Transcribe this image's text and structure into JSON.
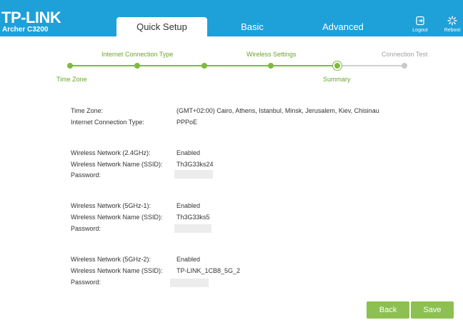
{
  "header": {
    "brand": "TP-LINK",
    "model": "Archer C3200",
    "tabs": [
      "Quick Setup",
      "Basic",
      "Advanced"
    ],
    "logout_label": "Logout",
    "reboot_label": "Reboot",
    "colors": {
      "header_bg": "#1ea0d8",
      "accent_green": "#7dbb3d"
    }
  },
  "steps": [
    {
      "label": "Time Zone",
      "state": "done"
    },
    {
      "label": "Internet Connection Type",
      "state": "done"
    },
    {
      "label": "",
      "state": "done"
    },
    {
      "label": "Wireless Settings",
      "state": "done"
    },
    {
      "label": "Summary",
      "state": "current"
    },
    {
      "label": "Connection Test",
      "state": "todo"
    }
  ],
  "summary": {
    "time_zone_label": "Time Zone:",
    "time_zone_value": "(GMT+02:00) Cairo, Athens, Istanbul, Minsk, Jerusalem, Kiev, Chisinau",
    "connection_type_label": "Internet Connection Type:",
    "connection_type_value": "PPPoE",
    "wifi_24": {
      "network_label": "Wireless Network (2.4GHz):",
      "network_value": "Enabled",
      "ssid_label": "Wireless Network Name (SSID):",
      "ssid_value": "Th3G33ks24",
      "password_label": "Password:"
    },
    "wifi_5_1": {
      "network_label": "Wireless Network (5GHz-1):",
      "network_value": "Enabled",
      "ssid_label": "Wireless Network Name (SSID):",
      "ssid_value": "Th3G33ks5",
      "password_label": "Password:"
    },
    "wifi_5_2": {
      "network_label": "Wireless Network (5GHz-2):",
      "network_value": "Enabled",
      "ssid_label": "Wireless Network Name (SSID):",
      "ssid_value": "TP-LINK_1CB8_5G_2",
      "password_label": "Password:"
    }
  },
  "buttons": {
    "back": "Back",
    "save": "Save"
  }
}
